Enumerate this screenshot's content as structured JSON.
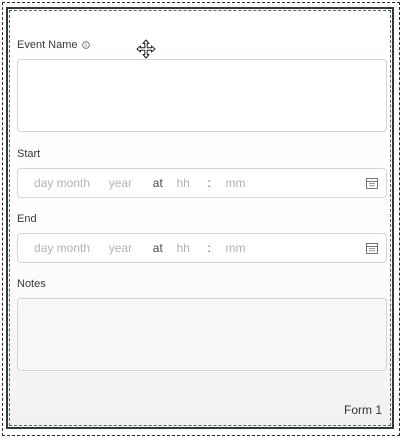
{
  "form": {
    "event_name": {
      "label": "Event Name",
      "icon": "info-icon",
      "value": ""
    },
    "start": {
      "label": "Start",
      "day_month_placeholder": "day month",
      "year_placeholder": "year",
      "at_text": "at",
      "hour_placeholder": "hh",
      "colon": ":",
      "minute_placeholder": "mm",
      "icon": "calendar-icon"
    },
    "end": {
      "label": "End",
      "day_month_placeholder": "day month",
      "year_placeholder": "year",
      "at_text": "at",
      "hour_placeholder": "hh",
      "colon": ":",
      "minute_placeholder": "mm",
      "icon": "calendar-icon"
    },
    "notes": {
      "label": "Notes",
      "value": ""
    },
    "footer_label": "Form 1"
  },
  "cursor": "move-cursor-icon",
  "colors": {
    "border": "#2e3b3a",
    "field_border": "#d6d6d6",
    "placeholder": "#b4b4b4",
    "label": "#3a3a3a"
  }
}
